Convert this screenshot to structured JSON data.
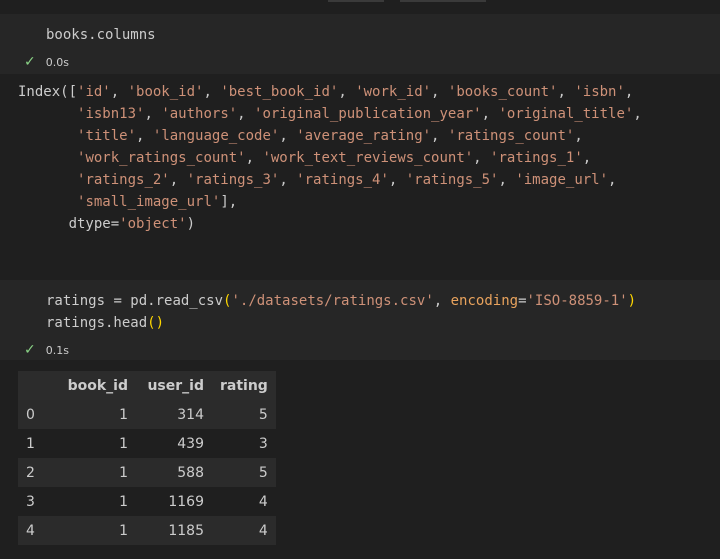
{
  "cell1": {
    "code": "books.columns",
    "status_check": "✓",
    "status_time": "0.0s"
  },
  "output1": {
    "lines": [
      "Index(['id', 'book_id', 'best_book_id', 'work_id', 'books_count', 'isbn',",
      "       'isbn13', 'authors', 'original_publication_year', 'original_title',",
      "       'title', 'language_code', 'average_rating', 'ratings_count',",
      "       'work_ratings_count', 'work_text_reviews_count', 'ratings_1',",
      "       'ratings_2', 'ratings_3', 'ratings_4', 'ratings_5', 'image_url',",
      "       'small_image_url'],",
      "      dtype='object')"
    ]
  },
  "cell2": {
    "line1_var": "ratings",
    "line1_eq": " = pd.read_csv",
    "line1_paren_open": "(",
    "line1_path": "'./datasets/ratings.csv'",
    "line1_sep": ", ",
    "line1_param": "encoding",
    "line1_eq2": "=",
    "line1_enc": "'ISO-8859-1'",
    "line1_paren_close": ")",
    "line2": "ratings.head",
    "line2_parens": "()",
    "status_check": "✓",
    "status_time": "0.1s"
  },
  "dataframe": {
    "columns": [
      "",
      "book_id",
      "user_id",
      "rating"
    ],
    "rows": [
      [
        "0",
        "1",
        "314",
        "5"
      ],
      [
        "1",
        "1",
        "439",
        "3"
      ],
      [
        "2",
        "1",
        "588",
        "5"
      ],
      [
        "3",
        "1",
        "1169",
        "4"
      ],
      [
        "4",
        "1",
        "1185",
        "4"
      ]
    ]
  }
}
